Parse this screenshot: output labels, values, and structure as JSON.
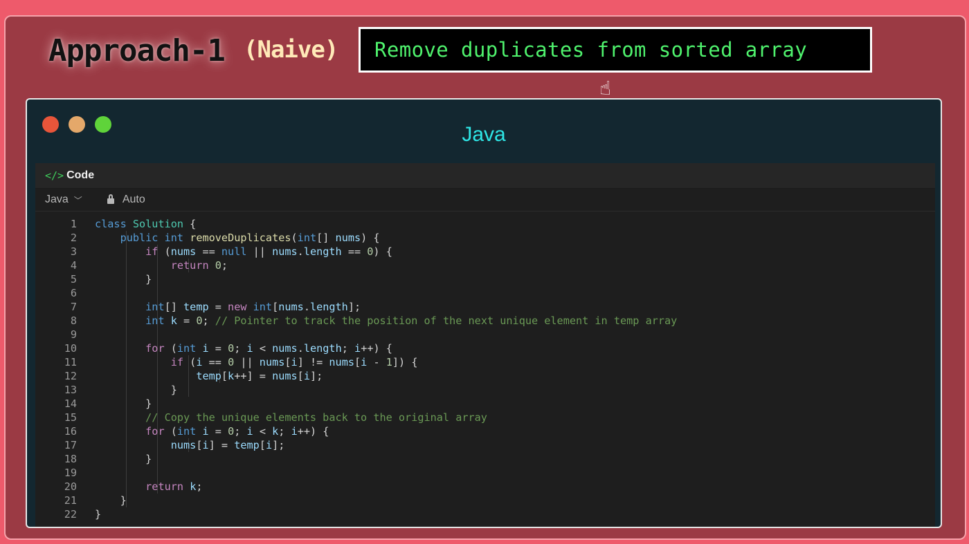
{
  "header": {
    "approach": "Approach-1",
    "naive": "(Naive)",
    "title": "Remove duplicates from sorted array"
  },
  "window": {
    "title": "Java",
    "tab_label": "Code",
    "tab_icon": "</>",
    "language": "Java",
    "mode": "Auto"
  },
  "code": {
    "line_numbers": [
      "1",
      "2",
      "3",
      "4",
      "5",
      "6",
      "7",
      "8",
      "9",
      "10",
      "11",
      "12",
      "13",
      "14",
      "15",
      "16",
      "17",
      "18",
      "19",
      "20",
      "21",
      "22"
    ],
    "lines": [
      "class Solution {",
      "    public int removeDuplicates(int[] nums) {",
      "        if (nums == null || nums.length == 0) {",
      "            return 0;",
      "        }",
      "",
      "        int[] temp = new int[nums.length];",
      "        int k = 0; // Pointer to track the position of the next unique element in temp array",
      "",
      "        for (int i = 0; i < nums.length; i++) {",
      "            if (i == 0 || nums[i] != nums[i - 1]) {",
      "                temp[k++] = nums[i];",
      "            }",
      "        }",
      "        // Copy the unique elements back to the original array",
      "        for (int i = 0; i < k; i++) {",
      "            nums[i] = temp[i];",
      "        }",
      "",
      "        return k;",
      "    }",
      "}"
    ]
  },
  "colors": {
    "keyword": "#c586c0",
    "builtin": "#569cd6",
    "type": "#4ec9b0",
    "function": "#dcdcaa",
    "variable": "#9cdcfe",
    "number": "#b5cea8",
    "comment": "#6a9955",
    "title_green": "#4ff26d",
    "java_cyan": "#2ee6e6"
  }
}
